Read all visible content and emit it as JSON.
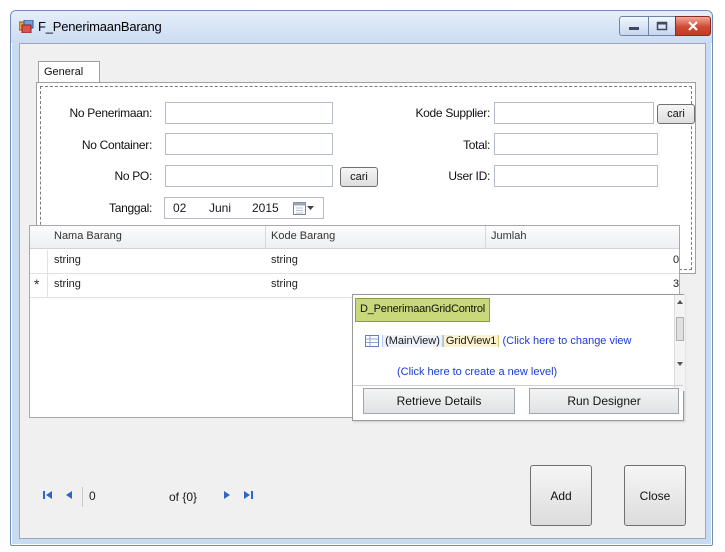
{
  "window": {
    "title": "F_PenerimaanBarang",
    "icon": "form-icon",
    "controls": [
      "minimize-icon",
      "maximize-icon",
      "close-icon"
    ]
  },
  "tabs": [
    {
      "label": "General",
      "selected": true
    }
  ],
  "form": {
    "no_penerimaan": {
      "label": "No Penerimaan:",
      "value": ""
    },
    "no_container": {
      "label": "No Container:",
      "value": ""
    },
    "no_po": {
      "label": "No PO:",
      "value": "",
      "button": "cari"
    },
    "tanggal": {
      "label": "Tanggal:",
      "day": "02",
      "month": "Juni",
      "year": "2015"
    },
    "kode_supplier": {
      "label": "Kode Supplier:",
      "value": "",
      "button": "cari"
    },
    "total": {
      "label": "Total:",
      "value": ""
    },
    "user_id": {
      "label": "User ID:",
      "value": ""
    }
  },
  "grid": {
    "columns": [
      "Nama Barang",
      "Kode Barang",
      "Jumlah"
    ],
    "rows": [
      {
        "indicator": "",
        "nama_barang": "string",
        "kode_barang": "string",
        "jumlah": "0"
      },
      {
        "indicator": "*",
        "nama_barang": "string",
        "kode_barang": "string",
        "jumlah": "3"
      }
    ]
  },
  "designer_popup": {
    "control_name": "D_PenerimaanGridControl",
    "main_view": "(MainView)",
    "view_name": "GridView1",
    "change_view_link": "(Click here to change view",
    "create_level_link": "(Click here to create a new level)",
    "buttons": [
      "Retrieve Details",
      "Run Designer"
    ]
  },
  "navigator": {
    "current": "0",
    "total_text": "of {0}"
  },
  "buttons": {
    "add": "Add",
    "close": "Close"
  },
  "colors": {
    "popup_title_bg": "#c8d87a",
    "link": "#1a3cd6",
    "close_button": "#c94530",
    "nav_icon": "#2e66c8"
  }
}
